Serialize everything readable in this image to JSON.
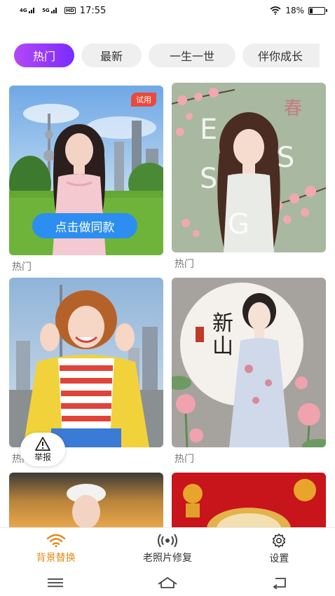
{
  "status_bar": {
    "network_1": "4G",
    "network_2": "5G",
    "hd_label": "HD",
    "time": "17:55",
    "battery": "18%"
  },
  "tabs": [
    {
      "label": "热门",
      "active": true
    },
    {
      "label": "最新",
      "active": false
    },
    {
      "label": "一生一世",
      "active": false
    },
    {
      "label": "伴你成长",
      "active": false
    }
  ],
  "cards": [
    {
      "label": "热门",
      "badge": "试用",
      "action": "点击做同款"
    },
    {
      "label": "热门",
      "overlay_text": "SPRING"
    },
    {
      "label": "热门"
    },
    {
      "label": "热门",
      "overlay_text": "新山"
    }
  ],
  "report": {
    "label": "举报"
  },
  "bottom_nav": {
    "items": [
      {
        "label": "背景替换",
        "icon": "wifi-signal-icon",
        "active": true
      },
      {
        "label": "老照片修复",
        "icon": "broadcast-icon",
        "active": false
      },
      {
        "label": "设置",
        "icon": "gear-icon",
        "active": false
      }
    ]
  },
  "colors": {
    "tab_active_start": "#b447f4",
    "tab_active_end": "#7a2cff",
    "nav_active": "#e08a1a",
    "action_button": "#2b8ef0",
    "badge": "#e94a3b"
  }
}
